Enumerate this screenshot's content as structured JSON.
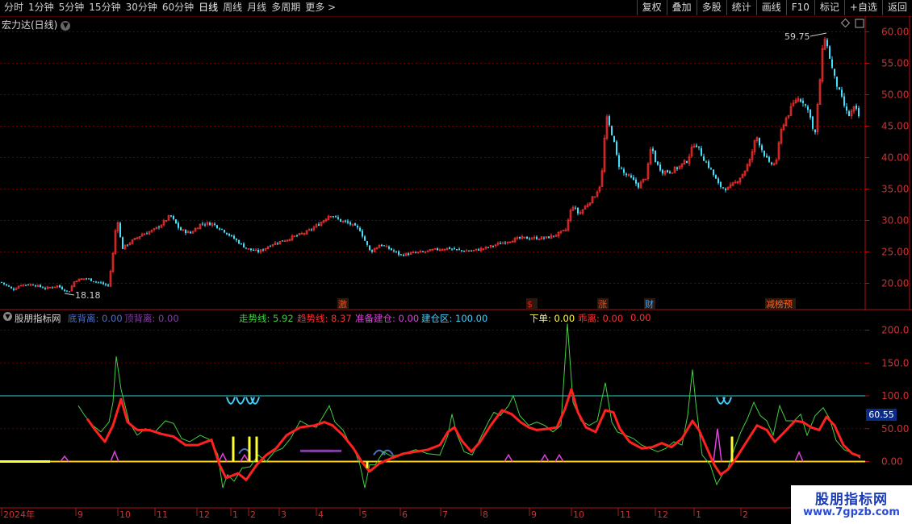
{
  "toolbar": {
    "periods": [
      "分时",
      "1分钟",
      "5分钟",
      "15分钟",
      "30分钟",
      "60分钟",
      "日线",
      "周线",
      "月线",
      "多周期",
      "更多"
    ],
    "active_period": "日线",
    "right_buttons": [
      "复权",
      "叠加",
      "多股",
      "统计",
      "画线",
      "F10",
      "标记",
      "+自选",
      "返回"
    ]
  },
  "main_panel": {
    "title": "宏力达(日线)",
    "high_label": "59.75",
    "low_label": "18.18",
    "events": [
      {
        "text": "激",
        "color": "#e05020"
      },
      {
        "text": "$",
        "color": "#e02020"
      },
      {
        "text": "涨",
        "color": "#e05020"
      },
      {
        "text": "财",
        "color": "#40a0ff"
      },
      {
        "text": "减榜预",
        "color": "#ff6020"
      }
    ]
  },
  "indicator_panel": {
    "name": "股朋指标网",
    "values": [
      {
        "label": "底背离:",
        "value": "0.00",
        "color": "#5070c0"
      },
      {
        "label": "顶背离:",
        "value": "0.00",
        "color": "#8040a0"
      },
      {
        "label": "走势线:",
        "value": "5.92",
        "color": "#40d040"
      },
      {
        "label": "趋势线:",
        "value": "8.37",
        "color": "#ff3030"
      },
      {
        "label": "准备建仓:",
        "value": "0.00",
        "color": "#e040e0"
      },
      {
        "label": "建仓区:",
        "value": "100.00",
        "color": "#40d0ff"
      },
      {
        "label": "下单:",
        "value": "0.00",
        "color": "#ffff40"
      },
      {
        "label": "乖离:",
        "value": "0.00",
        "color": "#ff3030"
      },
      {
        "label": "",
        "value": "0.00",
        "color": "#ff3030"
      }
    ],
    "current_value_badge": "60.55"
  },
  "axes": {
    "price_ticks": [
      "60.00",
      "55.00",
      "50.00",
      "45.00",
      "40.00",
      "35.00",
      "30.00",
      "25.00",
      "20.00"
    ],
    "indicator_ticks": [
      "200.0",
      "150.0",
      "100.0",
      "50.00",
      "0.00"
    ],
    "time_labels": [
      "2024年",
      "9",
      "10",
      "11",
      "12",
      "1",
      "2",
      "3",
      "4",
      "5",
      "6",
      "7",
      "8",
      "9",
      "10",
      "11",
      "12",
      "1",
      "2"
    ]
  },
  "watermark": {
    "title": "股朋指标网",
    "url": "www.7gpzb.com"
  },
  "colors": {
    "up": "#ff3030",
    "down": "#40e0ff",
    "trend_line": "#ff2020",
    "walk_line": "#40d040",
    "level_line": "#30d0d0",
    "zero_line": "#ffd020",
    "axis": "#b01010"
  },
  "chart_data": {
    "type": "line",
    "title": "宏力达(日线)",
    "price_ylim": [
      17,
      62
    ],
    "price_path": [
      [
        0,
        20.2
      ],
      [
        8,
        19.6
      ],
      [
        15,
        19.0
      ],
      [
        25,
        19.8
      ],
      [
        40,
        19.8
      ],
      [
        55,
        19.2
      ],
      [
        70,
        19.6
      ],
      [
        84,
        18.6
      ],
      [
        92,
        20.5
      ],
      [
        105,
        20.8
      ],
      [
        120,
        20.2
      ],
      [
        133,
        19.6
      ],
      [
        138,
        23.5
      ],
      [
        144,
        30.8
      ],
      [
        150,
        25.5
      ],
      [
        160,
        26.5
      ],
      [
        175,
        27.8
      ],
      [
        190,
        28.5
      ],
      [
        200,
        29.5
      ],
      [
        210,
        30.8
      ],
      [
        222,
        28.5
      ],
      [
        235,
        28.0
      ],
      [
        248,
        29.5
      ],
      [
        262,
        29.5
      ],
      [
        275,
        28.5
      ],
      [
        290,
        27.0
      ],
      [
        305,
        25.5
      ],
      [
        320,
        25.0
      ],
      [
        335,
        26.2
      ],
      [
        350,
        26.8
      ],
      [
        365,
        27.5
      ],
      [
        380,
        28.2
      ],
      [
        395,
        29.5
      ],
      [
        408,
        31.0
      ],
      [
        420,
        30.0
      ],
      [
        432,
        29.5
      ],
      [
        445,
        28.5
      ],
      [
        452,
        26.5
      ],
      [
        458,
        25.0
      ],
      [
        470,
        26.2
      ],
      [
        480,
        25.6
      ],
      [
        495,
        24.5
      ],
      [
        510,
        24.8
      ],
      [
        525,
        25.0
      ],
      [
        540,
        25.4
      ],
      [
        555,
        25.6
      ],
      [
        570,
        25.2
      ],
      [
        585,
        25.2
      ],
      [
        600,
        25.6
      ],
      [
        615,
        26.2
      ],
      [
        630,
        26.8
      ],
      [
        645,
        27.2
      ],
      [
        660,
        27.2
      ],
      [
        675,
        27.2
      ],
      [
        690,
        27.8
      ],
      [
        700,
        28.5
      ],
      [
        708,
        32.5
      ],
      [
        716,
        31.0
      ],
      [
        726,
        32.5
      ],
      [
        736,
        34.0
      ],
      [
        744,
        36.0
      ],
      [
        750,
        46.5
      ],
      [
        758,
        43.5
      ],
      [
        765,
        39.0
      ],
      [
        772,
        37.5
      ],
      [
        780,
        36.8
      ],
      [
        790,
        35.5
      ],
      [
        800,
        37.0
      ],
      [
        806,
        42.0
      ],
      [
        812,
        39.0
      ],
      [
        820,
        37.8
      ],
      [
        830,
        37.8
      ],
      [
        840,
        38.5
      ],
      [
        850,
        39.5
      ],
      [
        860,
        42.5
      ],
      [
        870,
        40.0
      ],
      [
        880,
        38.0
      ],
      [
        890,
        35.5
      ],
      [
        900,
        35.0
      ],
      [
        910,
        36.0
      ],
      [
        920,
        37.5
      ],
      [
        928,
        39.5
      ],
      [
        936,
        43.5
      ],
      [
        944,
        41.0
      ],
      [
        952,
        39.0
      ],
      [
        960,
        39.0
      ],
      [
        968,
        45.0
      ],
      [
        976,
        47.0
      ],
      [
        986,
        49.5
      ],
      [
        994,
        49.0
      ],
      [
        1004,
        46.5
      ],
      [
        1008,
        42.5
      ],
      [
        1014,
        51.0
      ],
      [
        1020,
        59.75
      ],
      [
        1026,
        56.5
      ],
      [
        1032,
        53.0
      ],
      [
        1040,
        50.0
      ],
      [
        1050,
        46.5
      ],
      [
        1058,
        48.0
      ],
      [
        1065,
        46.0
      ]
    ],
    "indicator_ylim": [
      -50,
      230
    ],
    "level_line": 100,
    "walk_line": [
      [
        97,
        85
      ],
      [
        105,
        70
      ],
      [
        115,
        55
      ],
      [
        125,
        45
      ],
      [
        135,
        60
      ],
      [
        140,
        90
      ],
      [
        144,
        160
      ],
      [
        150,
        110
      ],
      [
        160,
        60
      ],
      [
        170,
        40
      ],
      [
        180,
        50
      ],
      [
        192,
        45
      ],
      [
        205,
        62
      ],
      [
        215,
        58
      ],
      [
        225,
        35
      ],
      [
        235,
        30
      ],
      [
        248,
        40
      ],
      [
        262,
        32
      ],
      [
        270,
        10
      ],
      [
        276,
        -40
      ],
      [
        282,
        -20
      ],
      [
        290,
        -30
      ],
      [
        300,
        -10
      ],
      [
        310,
        -8
      ],
      [
        320,
        10
      ],
      [
        330,
        0
      ],
      [
        340,
        15
      ],
      [
        350,
        20
      ],
      [
        360,
        35
      ],
      [
        372,
        62
      ],
      [
        382,
        55
      ],
      [
        392,
        52
      ],
      [
        400,
        68
      ],
      [
        408,
        85
      ],
      [
        415,
        60
      ],
      [
        425,
        48
      ],
      [
        432,
        30
      ],
      [
        440,
        15
      ],
      [
        446,
        -5
      ],
      [
        452,
        -40
      ],
      [
        458,
        -5
      ],
      [
        465,
        -5
      ],
      [
        475,
        15
      ],
      [
        485,
        8
      ],
      [
        500,
        12
      ],
      [
        515,
        18
      ],
      [
        530,
        12
      ],
      [
        545,
        10
      ],
      [
        555,
        40
      ],
      [
        560,
        72
      ],
      [
        566,
        42
      ],
      [
        575,
        15
      ],
      [
        585,
        10
      ],
      [
        595,
        35
      ],
      [
        605,
        60
      ],
      [
        612,
        75
      ],
      [
        620,
        70
      ],
      [
        630,
        85
      ],
      [
        636,
        100
      ],
      [
        644,
        70
      ],
      [
        655,
        55
      ],
      [
        665,
        60
      ],
      [
        675,
        55
      ],
      [
        685,
        45
      ],
      [
        695,
        55
      ],
      [
        703,
        210
      ],
      [
        710,
        90
      ],
      [
        720,
        62
      ],
      [
        730,
        55
      ],
      [
        740,
        62
      ],
      [
        750,
        120
      ],
      [
        758,
        60
      ],
      [
        765,
        45
      ],
      [
        775,
        40
      ],
      [
        785,
        35
      ],
      [
        795,
        25
      ],
      [
        805,
        20
      ],
      [
        815,
        15
      ],
      [
        825,
        20
      ],
      [
        835,
        30
      ],
      [
        845,
        25
      ],
      [
        852,
        70
      ],
      [
        858,
        140
      ],
      [
        862,
        90
      ],
      [
        870,
        10
      ],
      [
        880,
        -5
      ],
      [
        888,
        -35
      ],
      [
        895,
        -20
      ],
      [
        902,
        -10
      ],
      [
        910,
        20
      ],
      [
        918,
        45
      ],
      [
        926,
        65
      ],
      [
        934,
        90
      ],
      [
        942,
        70
      ],
      [
        950,
        62
      ],
      [
        958,
        40
      ],
      [
        966,
        85
      ],
      [
        974,
        62
      ],
      [
        984,
        62
      ],
      [
        992,
        72
      ],
      [
        1000,
        40
      ],
      [
        1010,
        70
      ],
      [
        1020,
        82
      ],
      [
        1028,
        65
      ],
      [
        1036,
        32
      ],
      [
        1046,
        18
      ],
      [
        1058,
        12
      ],
      [
        1066,
        5
      ]
    ],
    "trend_line": [
      [
        108,
        65
      ],
      [
        118,
        48
      ],
      [
        130,
        30
      ],
      [
        140,
        55
      ],
      [
        150,
        95
      ],
      [
        158,
        60
      ],
      [
        170,
        48
      ],
      [
        185,
        48
      ],
      [
        200,
        42
      ],
      [
        215,
        38
      ],
      [
        230,
        25
      ],
      [
        245,
        25
      ],
      [
        262,
        33
      ],
      [
        272,
        -5
      ],
      [
        280,
        -25
      ],
      [
        295,
        -18
      ],
      [
        305,
        -28
      ],
      [
        318,
        -5
      ],
      [
        330,
        10
      ],
      [
        342,
        20
      ],
      [
        355,
        40
      ],
      [
        372,
        52
      ],
      [
        390,
        55
      ],
      [
        402,
        60
      ],
      [
        412,
        55
      ],
      [
        425,
        40
      ],
      [
        438,
        20
      ],
      [
        448,
        0
      ],
      [
        458,
        -15
      ],
      [
        470,
        -3
      ],
      [
        485,
        5
      ],
      [
        500,
        12
      ],
      [
        515,
        15
      ],
      [
        530,
        18
      ],
      [
        545,
        25
      ],
      [
        555,
        45
      ],
      [
        563,
        52
      ],
      [
        572,
        32
      ],
      [
        584,
        15
      ],
      [
        595,
        30
      ],
      [
        608,
        55
      ],
      [
        622,
        78
      ],
      [
        634,
        72
      ],
      [
        645,
        60
      ],
      [
        655,
        52
      ],
      [
        665,
        48
      ],
      [
        680,
        50
      ],
      [
        690,
        52
      ],
      [
        700,
        80
      ],
      [
        708,
        110
      ],
      [
        716,
        75
      ],
      [
        726,
        52
      ],
      [
        738,
        45
      ],
      [
        750,
        78
      ],
      [
        760,
        75
      ],
      [
        768,
        50
      ],
      [
        780,
        30
      ],
      [
        795,
        20
      ],
      [
        808,
        22
      ],
      [
        820,
        28
      ],
      [
        832,
        22
      ],
      [
        845,
        35
      ],
      [
        858,
        62
      ],
      [
        866,
        48
      ],
      [
        876,
        20
      ],
      [
        885,
        -5
      ],
      [
        893,
        -20
      ],
      [
        902,
        -12
      ],
      [
        912,
        5
      ],
      [
        925,
        30
      ],
      [
        938,
        55
      ],
      [
        950,
        48
      ],
      [
        960,
        30
      ],
      [
        972,
        45
      ],
      [
        985,
        62
      ],
      [
        995,
        60
      ],
      [
        1005,
        52
      ],
      [
        1015,
        48
      ],
      [
        1024,
        68
      ],
      [
        1034,
        55
      ],
      [
        1045,
        25
      ],
      [
        1056,
        12
      ],
      [
        1066,
        8
      ]
    ],
    "magenta_spikes": [
      [
        80,
        8
      ],
      [
        142,
        15
      ],
      [
        276,
        12
      ],
      [
        303,
        10
      ],
      [
        630,
        10
      ],
      [
        675,
        10
      ],
      [
        693,
        10
      ],
      [
        889,
        50
      ],
      [
        990,
        14
      ]
    ],
    "yellow_bars": [
      [
        289,
        38
      ],
      [
        309,
        38
      ],
      [
        318,
        38
      ],
      [
        455,
        -10
      ],
      [
        907,
        38
      ]
    ],
    "cyan_bumps": [
      [
        286,
        98
      ],
      [
        298,
        98
      ],
      [
        310,
        98
      ],
      [
        316,
        98
      ],
      [
        893,
        98
      ],
      [
        901,
        98
      ]
    ],
    "blue_humps": [
      [
        303,
        20
      ],
      [
        470,
        18
      ],
      [
        480,
        18
      ]
    ],
    "purple_humps": [
      [
        392,
        18
      ],
      [
        403,
        18
      ]
    ]
  }
}
